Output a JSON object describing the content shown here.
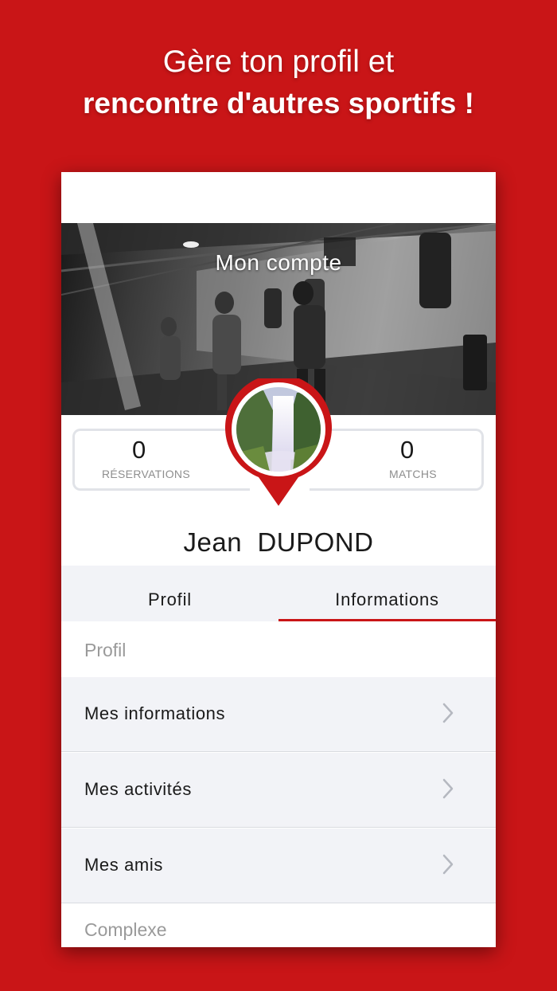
{
  "headline": {
    "line1": "Gère ton profil et",
    "line2": "rencontre d'autres sportifs !"
  },
  "header": {
    "title": "Mon compte"
  },
  "stats": {
    "reservations": {
      "value": "0",
      "label": "RÉSERVATIONS"
    },
    "matchs": {
      "value": "0",
      "label": "MATCHS"
    }
  },
  "user": {
    "name": "Jean  DUPOND"
  },
  "tabs": [
    {
      "label": "Profil",
      "active": false
    },
    {
      "label": "Informations",
      "active": true
    }
  ],
  "sections": {
    "profil": {
      "title": "Profil",
      "items": [
        {
          "label": "Mes informations",
          "icon": "chevron-right-icon"
        },
        {
          "label": "Mes activités",
          "icon": "chevron-right-icon"
        },
        {
          "label": "Mes amis",
          "icon": "chevron-right-icon"
        }
      ]
    },
    "complexe": {
      "title": "Complexe"
    }
  },
  "colors": {
    "brand_red": "#c91517",
    "tab_indicator": "#c91517",
    "list_background": "#f2f3f7"
  }
}
